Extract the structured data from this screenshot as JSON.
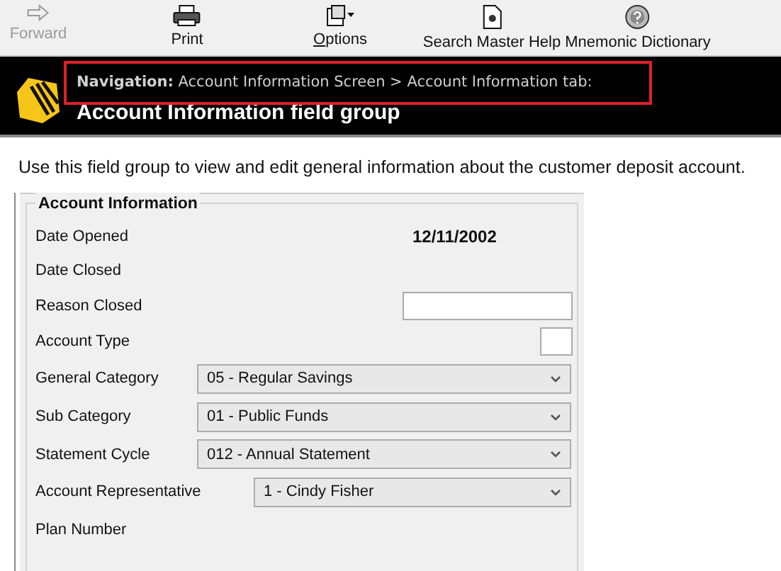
{
  "toolbar": [
    {
      "label": "Forward",
      "disabled": true
    },
    {
      "label": "Print",
      "disabled": false
    },
    {
      "label": "Options",
      "disabled": false
    },
    {
      "label": "Search Master Help",
      "disabled": false
    },
    {
      "label": "Mnemonic Dictionary",
      "disabled": false
    }
  ],
  "header": {
    "navigation": "**Navigation:** Account Information Screen > Account Information tab:",
    "title": "Account Information field group"
  },
  "intro": "Use this field group to view and edit general information about the customer deposit account.",
  "group": {
    "title": "Account Information",
    "fields": [
      {
        "label": "Date Opened",
        "kind": "text",
        "value": "12/11/2002"
      },
      {
        "label": "Date Closed",
        "kind": "none"
      },
      {
        "label": "Reason Closed",
        "kind": "input"
      },
      {
        "label": "Account Type",
        "kind": "small-input"
      },
      {
        "label": "General Category",
        "kind": "select",
        "value": "05 - Regular Savings"
      },
      {
        "label": "Sub Category",
        "kind": "select",
        "value": "01 - Public Funds"
      },
      {
        "label": "Statement Cycle",
        "kind": "select",
        "value": "012 - Annual Statement"
      },
      {
        "label": "Account Representative",
        "kind": "select-wide",
        "value": "1 - Cindy Fisher"
      },
      {
        "label": "Plan Number",
        "kind": "none"
      }
    ]
  }
}
